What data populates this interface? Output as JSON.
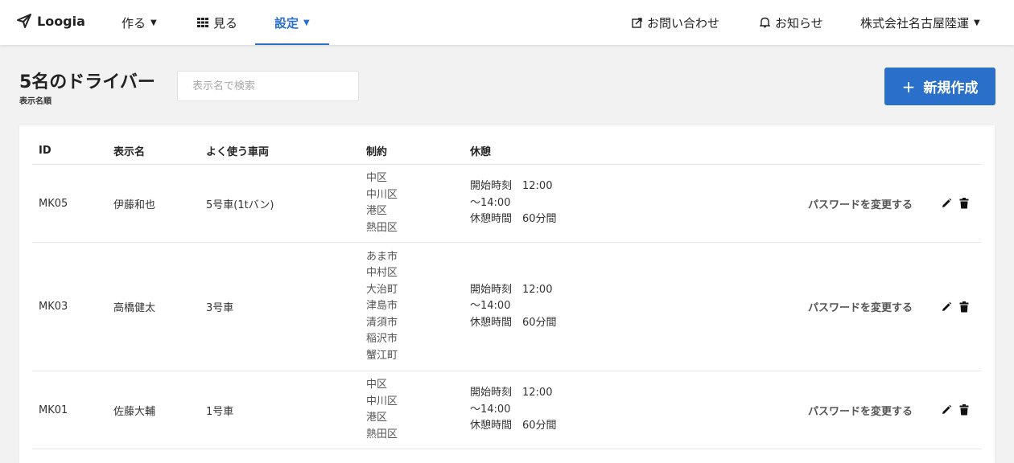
{
  "nav": {
    "logo": "Loogia",
    "make": "作る",
    "view": "見る",
    "settings": "設定",
    "contact": "お問い合わせ",
    "notice": "お知らせ",
    "company": "株式会社名古屋陸運"
  },
  "header": {
    "title": "5名のドライバー",
    "sort": "表示名順",
    "search_placeholder": "表示名で検索",
    "new_button": "新規作成",
    "new_plus": "+"
  },
  "table": {
    "columns": [
      "ID",
      "表示名",
      "よく使う車両",
      "制約",
      "休憩"
    ],
    "rows": [
      {
        "id": "MK05",
        "name": "伊藤和也",
        "vehicle": "5号車(1tバン)",
        "constraints": [
          "中区",
          "中川区",
          "港区",
          "熱田区"
        ],
        "break": [
          "開始時刻　12:00",
          "〜14:00",
          "休憩時間　60分間"
        ],
        "password_link": "パスワードを変更する"
      },
      {
        "id": "MK03",
        "name": "高橋健太",
        "vehicle": "3号車",
        "constraints": [
          "あま市",
          "中村区",
          "大治町",
          "津島市",
          "清須市",
          "稲沢市",
          "蟹江町"
        ],
        "break": [
          "開始時刻　12:00",
          "〜14:00",
          "休憩時間　60分間"
        ],
        "password_link": "パスワードを変更する"
      },
      {
        "id": "MK01",
        "name": "佐藤大輔",
        "vehicle": "1号車",
        "constraints": [
          "中区",
          "中川区",
          "港区",
          "熱田区"
        ],
        "break": [
          "開始時刻　12:00",
          "〜14:00",
          "休憩時間　60分間"
        ],
        "password_link": "パスワードを変更する"
      }
    ]
  },
  "colors": {
    "accent": "#2a6fc9",
    "background": "#f2f2f2"
  },
  "icons": [
    "paper-plane-icon",
    "caret-down-icon",
    "grid-icon",
    "external-link-icon",
    "bell-icon",
    "pencil-icon",
    "trash-icon"
  ]
}
